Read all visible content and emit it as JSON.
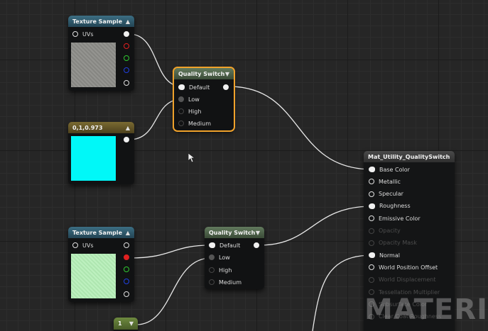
{
  "graph": {
    "texture_sample_1": {
      "title": "Texture Sample",
      "pins": {
        "uvs": "UVs"
      },
      "thumb_color": "#8e8e8a"
    },
    "quality_switch_1": {
      "title": "Quality Switch",
      "pins": {
        "default": "Default",
        "low": "Low",
        "high": "High",
        "medium": "Medium"
      }
    },
    "constant3": {
      "title": "0,1,0.973",
      "swatch_color": "#00f8f8"
    },
    "texture_sample_2": {
      "title": "Texture Sample",
      "pins": {
        "uvs": "UVs"
      },
      "thumb_color": "#b6ecb8"
    },
    "quality_switch_2": {
      "title": "Quality Switch",
      "pins": {
        "default": "Default",
        "low": "Low",
        "high": "High",
        "medium": "Medium"
      }
    },
    "constant1": {
      "title": "1"
    },
    "material_output": {
      "title": "Mat_Utility_QualitySwitch",
      "inputs": [
        {
          "label": "Base Color",
          "active": true
        },
        {
          "label": "Metallic",
          "active": true
        },
        {
          "label": "Specular",
          "active": true
        },
        {
          "label": "Roughness",
          "active": true
        },
        {
          "label": "Emissive Color",
          "active": true
        },
        {
          "label": "Opacity",
          "active": false
        },
        {
          "label": "Opacity Mask",
          "active": false
        },
        {
          "label": "Normal",
          "active": true
        },
        {
          "label": "World Position Offset",
          "active": true
        },
        {
          "label": "World Displacement",
          "active": false
        },
        {
          "label": "Tessellation Multiplier",
          "active": false
        },
        {
          "label": "Subsurface Color",
          "active": false
        },
        {
          "label": "Clear Coat Roughness",
          "active": false
        }
      ]
    },
    "watermark": "MATERIAL"
  },
  "colors": {
    "red_pin": "#e02020",
    "green_pin": "#30c830",
    "blue_pin": "#2040e0",
    "selection": "#f0a22b"
  }
}
